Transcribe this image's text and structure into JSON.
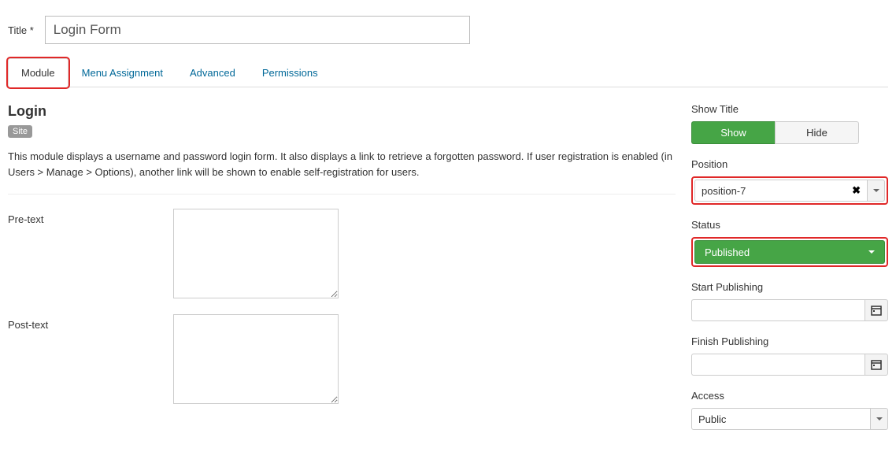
{
  "title_field": {
    "label": "Title *",
    "value": "Login Form"
  },
  "tabs": {
    "module": "Module",
    "menu_assignment": "Menu Assignment",
    "advanced": "Advanced",
    "permissions": "Permissions"
  },
  "main": {
    "heading": "Login",
    "badge": "Site",
    "description": "This module displays a username and password login form. It also displays a link to retrieve a forgotten password. If user registration is enabled (in Users > Manage > Options), another link will be shown to enable self-registration for users.",
    "pre_text_label": "Pre-text",
    "pre_text_value": "",
    "post_text_label": "Post-text",
    "post_text_value": ""
  },
  "side": {
    "show_title_label": "Show Title",
    "show_title_show": "Show",
    "show_title_hide": "Hide",
    "position_label": "Position",
    "position_value": "position-7",
    "status_label": "Status",
    "status_value": "Published",
    "start_pub_label": "Start Publishing",
    "start_pub_value": "",
    "finish_pub_label": "Finish Publishing",
    "finish_pub_value": "",
    "access_label": "Access",
    "access_value": "Public"
  }
}
